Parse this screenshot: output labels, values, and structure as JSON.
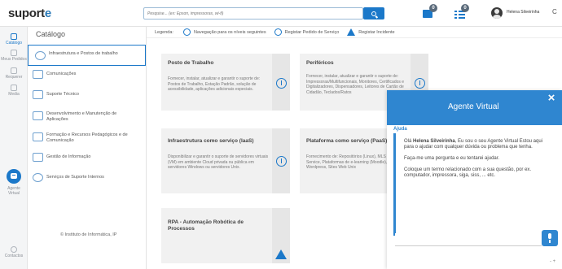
{
  "header": {
    "logo_main": "suport",
    "logo_accent": "e",
    "search_placeholder": "Pesquise... (ex: Epson, impressoras, wi-fi)",
    "notification_badge": "0",
    "list_badge": "0",
    "user_name": "Helena Silveirinha",
    "user_extra": "C"
  },
  "rail": {
    "items": [
      {
        "label": "Catálogo"
      },
      {
        "label": "Meus Pedidos"
      },
      {
        "label": "Requerer"
      },
      {
        "label": "Media"
      }
    ],
    "agent_label_1": "Agente",
    "agent_label_2": "Virtual",
    "contacts_label": "Contactos"
  },
  "catalog": {
    "title": "Catálogo",
    "items": [
      {
        "label": "Infraestrutura e Postos de trabalho"
      },
      {
        "label": "Comunicações"
      },
      {
        "label": "Suporte Técnico"
      },
      {
        "label": "Desenvolvimento e Manutenção de Aplicações"
      },
      {
        "label": "Formação e Recursos Pedagógicos e de Comunicação"
      },
      {
        "label": "Gestão de Informação"
      },
      {
        "label": "Serviços de Suporte Internos"
      }
    ],
    "footer": "© Instituto de Informática, IP"
  },
  "legend": {
    "label": "Legenda:",
    "items": [
      {
        "text": "Navegação para os níveis seguintes"
      },
      {
        "text": "Registar Pedido de Serviço"
      },
      {
        "text": "Registar Incidente"
      }
    ]
  },
  "cards": [
    {
      "title": "Posto de Trabalho",
      "body": "Fornecer, instalar, atualizar e garantir o suporte de: Postos de Trabalho, Estação Padrão, solução de acessibilidade, aplicações adicionais especiais."
    },
    {
      "title": "Periféricos",
      "body": "Fornecer, instalar, atualizar e garantir o suporte de: Impressoras/Multifuncionais, Monitores, Certificados e Digitalizadores, Dispensadores, Leitores de Cartão de Cidadão, Teclados/Ratos"
    },
    {
      "title": "Infraestrutura como serviço (IaaS)",
      "body": "Disponibilizar e garantir o suporte de servidores virtuais (VM) em ambiente Cloud privada ou pública em servidores Windows ou servidores Unix."
    },
    {
      "title": "Plataforma como serviço (PaaS)",
      "body": "Fornecimento de: Repositórios (Linux), MLS - Mailing List Service, Plataformas de e-learning (Moodle), Sites Web Wordpress, Sites Web Unix"
    },
    {
      "title": "RPA - Automação Robótica de Processos",
      "body": ""
    }
  ],
  "agent": {
    "title": "Agente Virtual",
    "close_label": "×",
    "section_label": "Ajuda",
    "greeting_prefix": "Olá ",
    "greeting_name": "Helena Silveirinha",
    "greeting_suffix": ", Eu sou o seu Agente Virtual Estou aqui para o ajudar com qualquer dúvida ou problema que tenha.",
    "prompt": "Faça-me uma pergunta e eu tentarei ajudar.",
    "hint": "Coloque um termo relacionado com a sua questão, por ex. computador, impressora, siga, siss, ... etc.",
    "input_value": "",
    "dots": "- +"
  },
  "colors": {
    "accent": "#1b78c9",
    "agent_header": "#2f86d0",
    "card_bg": "#f1f1f1"
  }
}
